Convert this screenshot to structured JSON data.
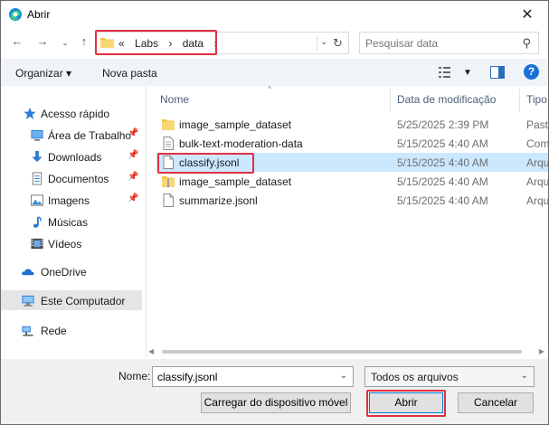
{
  "window": {
    "title": "Abrir",
    "close_glyph": "✕"
  },
  "address": {
    "crumbs": [
      "«",
      "Labs",
      "›",
      "data",
      "›"
    ],
    "search_placeholder": "Pesquisar data"
  },
  "toolbar": {
    "organize_label": "Organizar ▾",
    "new_folder_label": "Nova pasta",
    "help_glyph": "?"
  },
  "nav": {
    "items": [
      {
        "label": "Acesso rápido",
        "icon": "star-icon"
      },
      {
        "label": "Área de Trabalho",
        "icon": "desktop-icon",
        "pinned": true
      },
      {
        "label": "Downloads",
        "icon": "download-icon",
        "pinned": true
      },
      {
        "label": "Documentos",
        "icon": "documents-icon",
        "pinned": true
      },
      {
        "label": "Imagens",
        "icon": "pictures-icon",
        "pinned": true
      },
      {
        "label": "Músicas",
        "icon": "music-icon"
      },
      {
        "label": "Vídeos",
        "icon": "videos-icon"
      },
      {
        "label": "OneDrive",
        "icon": "cloud-icon"
      },
      {
        "label": "Este Computador",
        "icon": "computer-icon",
        "selected": true
      },
      {
        "label": "Rede",
        "icon": "network-icon"
      }
    ]
  },
  "columns": {
    "name": "Nome",
    "date": "Data de modificação",
    "type": "Tipo"
  },
  "files": [
    {
      "name": "image_sample_dataset",
      "date": "5/25/2025 2:39 PM",
      "type": "Pasta",
      "icon": "folder-icon"
    },
    {
      "name": "bulk-text-moderation-data",
      "date": "5/15/2025 4:40 AM",
      "type": "Com",
      "icon": "file-icon"
    },
    {
      "name": "classify.jsonl",
      "date": "5/15/2025 4:40 AM",
      "type": "Arqu",
      "icon": "file-icon",
      "selected": true
    },
    {
      "name": "image_sample_dataset",
      "date": "5/15/2025 4:40 AM",
      "type": "Arqu",
      "icon": "zip-folder-icon"
    },
    {
      "name": "summarize.jsonl",
      "date": "5/15/2025 4:40 AM",
      "type": "Arqu",
      "icon": "file-icon"
    }
  ],
  "bottom": {
    "name_label": "Nome:",
    "name_value": "classify.jsonl",
    "filter_value": "Todos os arquivos",
    "upload_label": "Carregar do dispositivo móvel",
    "open_label": "Abrir",
    "cancel_label": "Cancelar"
  },
  "colors": {
    "accent": "#0078d7",
    "highlight": "#e03040",
    "selection": "#cce8ff"
  }
}
